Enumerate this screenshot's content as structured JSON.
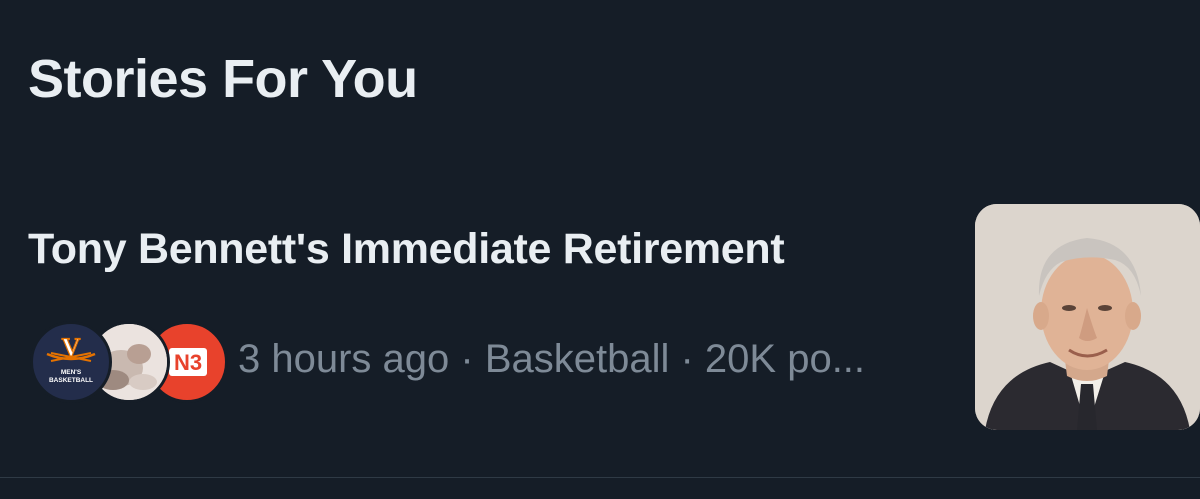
{
  "section": {
    "title": "Stories For You"
  },
  "story": {
    "headline": "Tony Bennett's Immediate Retirement",
    "meta": "3 hours ago · Basketball · 20K po...",
    "avatars": [
      {
        "name": "virginia-mens-basketball-avatar",
        "logo_letter": "V",
        "logo_text_1": "MEN'S",
        "logo_text_2": "BASKETBALL"
      },
      {
        "name": "user-photo-avatar"
      },
      {
        "name": "n3-avatar",
        "logo_text": "N3"
      }
    ],
    "thumbnail_icon": "portrait-photo"
  },
  "colors": {
    "background": "#151d27",
    "primary_text": "#e9eef2",
    "secondary_text": "#7e8a97",
    "divider": "#2f3a45",
    "uva_navy": "#232d4b",
    "uva_orange": "#e57200",
    "n3_red": "#e8422c"
  }
}
